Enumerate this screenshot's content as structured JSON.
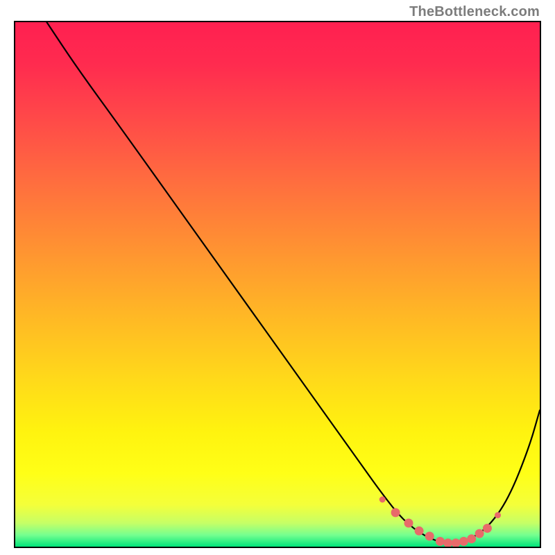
{
  "watermark": "TheBottleneck.com",
  "gradient": {
    "stops": [
      {
        "offset": 0.0,
        "color": "#ff2050"
      },
      {
        "offset": 0.08,
        "color": "#ff2b4f"
      },
      {
        "offset": 0.18,
        "color": "#ff4849"
      },
      {
        "offset": 0.3,
        "color": "#ff6c3f"
      },
      {
        "offset": 0.42,
        "color": "#ff8f33"
      },
      {
        "offset": 0.55,
        "color": "#ffb526"
      },
      {
        "offset": 0.68,
        "color": "#ffd91a"
      },
      {
        "offset": 0.78,
        "color": "#fff30f"
      },
      {
        "offset": 0.86,
        "color": "#ffff17"
      },
      {
        "offset": 0.92,
        "color": "#f4ff3a"
      },
      {
        "offset": 0.955,
        "color": "#c6ff66"
      },
      {
        "offset": 0.978,
        "color": "#74ff90"
      },
      {
        "offset": 1.0,
        "color": "#00e47a"
      }
    ]
  },
  "chart_data": {
    "type": "line",
    "title": "",
    "xlabel": "",
    "ylabel": "",
    "xlim": [
      0,
      100
    ],
    "ylim": [
      0,
      100
    ],
    "note": "Values are percentage positions within the plot frame (x left→right, y bottom→top). Curve points describe the black V-shaped bottleneck curve. Marker points describe the pink/red markers near the trough.",
    "series": [
      {
        "name": "bottleneck-curve",
        "x": [
          6,
          12,
          20,
          30,
          40,
          50,
          60,
          65,
          70,
          74,
          78,
          82,
          86,
          90,
          94,
          98,
          100
        ],
        "y": [
          100,
          91,
          80,
          66,
          52,
          38,
          24,
          17,
          10,
          5,
          2,
          0.5,
          1,
          3.5,
          9,
          19,
          26
        ]
      },
      {
        "name": "marker-dots",
        "x": [
          70,
          72.5,
          75,
          77,
          79,
          81,
          82.5,
          84,
          85.5,
          87,
          88.5,
          90,
          92
        ],
        "y": [
          9,
          6.5,
          4.5,
          3,
          2,
          1,
          0.7,
          0.7,
          1,
          1.5,
          2.5,
          3.5,
          6
        ]
      }
    ]
  }
}
